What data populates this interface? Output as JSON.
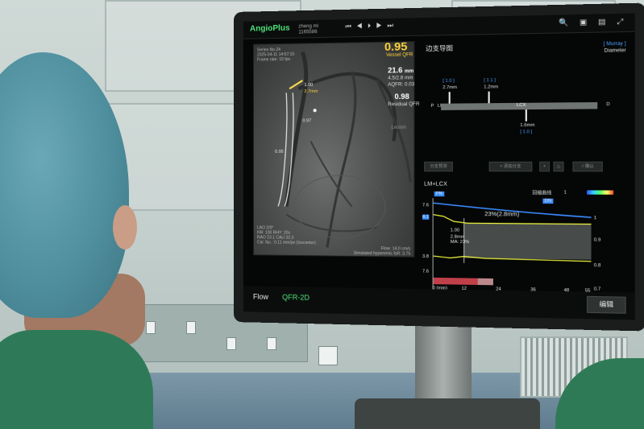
{
  "app": {
    "brand": "AngioPlus",
    "user_line1": "zheng mi",
    "user_line2": "1165586",
    "playback_icons": "⏮ ◀ ⏵ ▶ ⏭",
    "tool_icons": "🔍 ▣ ▤ ⤢"
  },
  "angio": {
    "series": "Series No.24",
    "date": "2025-04-11 14:57:15",
    "frame_rate": "Frame rate: 15 fps",
    "label_lm": "1.00",
    "label_lm_sub": "2.7mm",
    "label_mid": "0.97",
    "label_lower": "0.95",
    "bottom_meta_1": "LAO 2/0°",
    "bottom_meta_2": "HR: 100  RHY: 20s",
    "bottom_meta_3": "RAO 23.1 CAU 32.3",
    "bottom_meta_4": "Cal. fac.: 0.11 mm/px (Isocenter)",
    "flow": "Flow: 14.0 cm/s",
    "hyperemic": "Simulated hyperemic fsR: 3.75"
  },
  "metrics": {
    "qfr_value": "0.95",
    "qfr_label": "Vessel QFR",
    "length_value": "21.6",
    "length_unit": "mm",
    "diameters": "4.5/2.8 mm",
    "aqfr": "AQFR: 0.03",
    "residual_value": "0.98",
    "residual_label": "Residual QFR",
    "lesion": "Lesion"
  },
  "tree": {
    "title": "边支导图",
    "mode_line1": "[ Murray ]",
    "mode_line2": "Diameter",
    "marker_top_1": "[ 1.0 ]",
    "marker_top_2": "[ 1.1 ]",
    "marker_top_1_sub": "2.7mm",
    "marker_top_2_sub": "1.2mm",
    "p_label": "P",
    "lm_label": "LM",
    "lcx_label": "LCX",
    "d_label": "D",
    "marker_bottom": "[ 1.0 ]",
    "marker_bottom_sub": "1.6mm"
  },
  "buttons": [
    "分支预测",
    "+ 添加分支",
    "+",
    "△",
    "√ 确认"
  ],
  "plot": {
    "title": "LM+LCX",
    "legend_label": "回缩曲线",
    "legend_min": "1",
    "legend_max": "0.6",
    "pn_marker": "PN",
    "dn_marker": "DN",
    "left_axis": [
      "7.6",
      "4.1",
      "3.8",
      "7.6"
    ],
    "right_axis": [
      "1",
      "0.9",
      "0.8",
      "0.7"
    ],
    "x_axis": [
      "0 (mm)",
      "12",
      "24",
      "36",
      "48",
      "55"
    ],
    "stenosis_label": "23%(2.8mm)",
    "point_label": "1.00",
    "point_sub_1": "2.8mm",
    "point_sub_2": "MA: 23%",
    "lesion_unit": "mm"
  },
  "bottom": {
    "tab_flow": "Flow",
    "tab_qfr": "QFR-2D",
    "edit": "编辑"
  },
  "colors": {
    "brand": "#4fe37a",
    "qfr": "#ffd23a",
    "marker_blue": "#4ba3ff",
    "curve_yellow": "#e8f03a",
    "curve_blue": "#3a8cff"
  }
}
